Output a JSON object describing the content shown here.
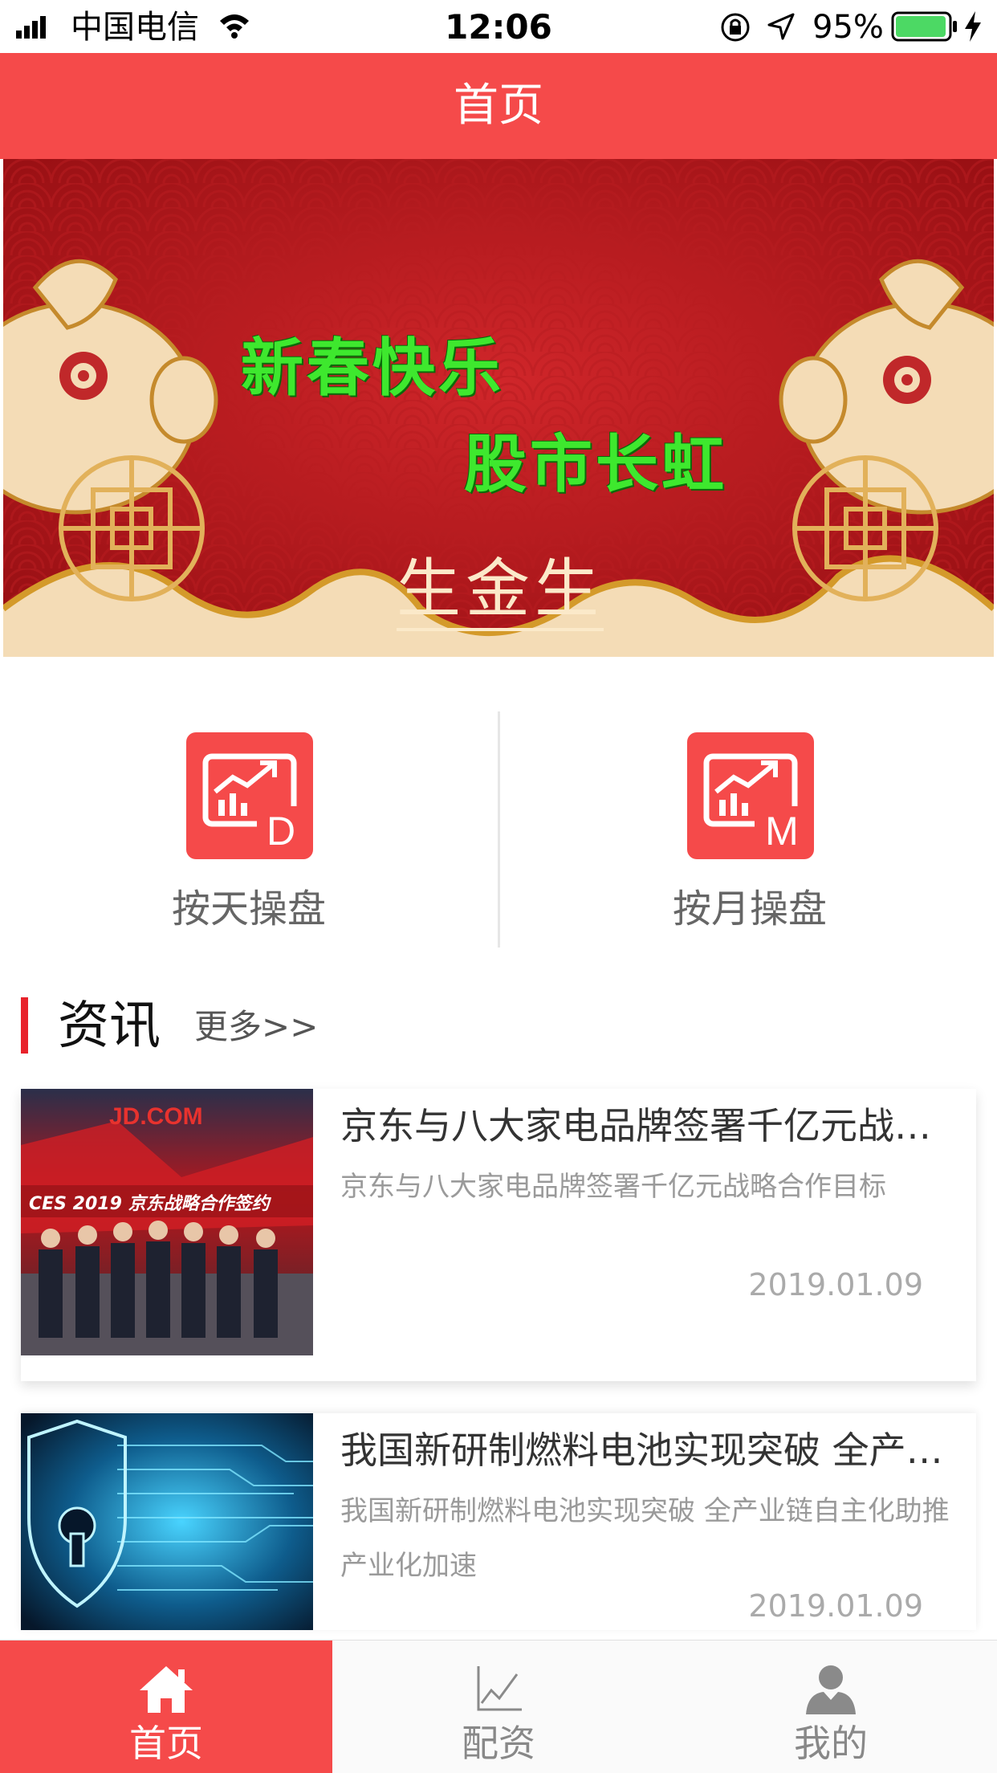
{
  "status_bar": {
    "carrier": "中国电信",
    "time": "12:06",
    "battery": "95%"
  },
  "nav": {
    "title": "首页"
  },
  "banner": {
    "line1": "新春快乐",
    "line2": "股市长虹",
    "brand": "生金生"
  },
  "actions": [
    {
      "label": "按天操盘",
      "icon": "daily-chart-icon",
      "letter": "D"
    },
    {
      "label": "按月操盘",
      "icon": "monthly-chart-icon",
      "letter": "M"
    }
  ],
  "news_section": {
    "title": "资讯",
    "more": "更多>>"
  },
  "news": [
    {
      "title": "京东与八大家电品牌签署千亿元战略合作目标",
      "summary": "京东与八大家电品牌签署千亿元战略合作目标",
      "date": "2019.01.09",
      "thumb_logo": "JD.COM",
      "thumb_caption": "CES 2019  京东战略合作签约"
    },
    {
      "title": "我国新研制燃料电池实现突破 全产业链自主化助推产业化加速",
      "summary": "我国新研制燃料电池实现突破 全产业链自主化助推产业化加速",
      "date": "2019.01.09"
    }
  ],
  "tabs": [
    {
      "label": "首页",
      "icon": "home-icon",
      "active": true
    },
    {
      "label": "配资",
      "icon": "chart-icon",
      "active": false
    },
    {
      "label": "我的",
      "icon": "user-icon",
      "active": false
    }
  ],
  "colors": {
    "brand_red": "#f54a4a",
    "section_mark": "#e8222b",
    "banner_green_text": "#3ee82e"
  }
}
